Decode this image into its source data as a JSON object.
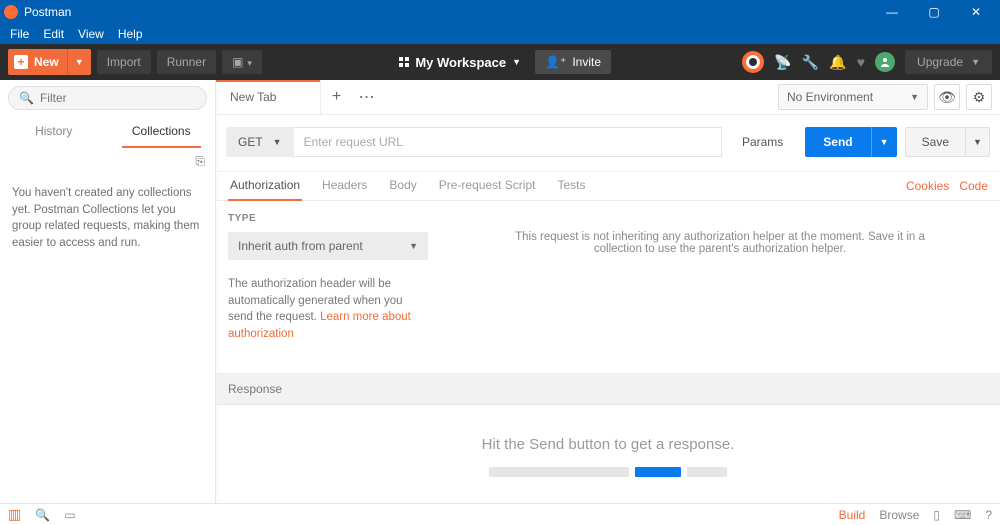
{
  "window": {
    "title": "Postman",
    "controls": {
      "minimize": "—",
      "maximize": "▢",
      "close": "✕"
    }
  },
  "menubar": [
    "File",
    "Edit",
    "View",
    "Help"
  ],
  "toolbar": {
    "new_label": "New",
    "import_label": "Import",
    "runner_label": "Runner",
    "workspace_label": "My Workspace",
    "invite_label": "Invite",
    "upgrade_label": "Upgrade"
  },
  "sidebar": {
    "filter_placeholder": "Filter",
    "tabs": {
      "history": "History",
      "collections": "Collections"
    },
    "empty_message": "You haven't created any collections yet. Postman Collections let you group related requests, making them easier to access and run."
  },
  "tabs_strip": {
    "tab0": "New Tab"
  },
  "environment": {
    "selected": "No Environment"
  },
  "request_row": {
    "method": "GET",
    "url_placeholder": "Enter request URL",
    "params_label": "Params",
    "send_label": "Send",
    "save_label": "Save"
  },
  "lower_tabs": {
    "authorization": "Authorization",
    "headers": "Headers",
    "body": "Body",
    "prerequest": "Pre-request Script",
    "tests": "Tests",
    "cookies": "Cookies",
    "code": "Code"
  },
  "auth_panel": {
    "type_label": "TYPE",
    "type_selected": "Inherit auth from parent",
    "description": "The authorization header will be automatically generated when you send the request. ",
    "learn_more": "Learn more about authorization",
    "inherit_message": "This request is not inheriting any authorization helper at the moment. Save it in a collection to use the parent's authorization helper."
  },
  "response": {
    "header": "Response",
    "empty_message": "Hit the Send button to get a response."
  },
  "statusbar": {
    "build": "Build",
    "browse": "Browse"
  }
}
